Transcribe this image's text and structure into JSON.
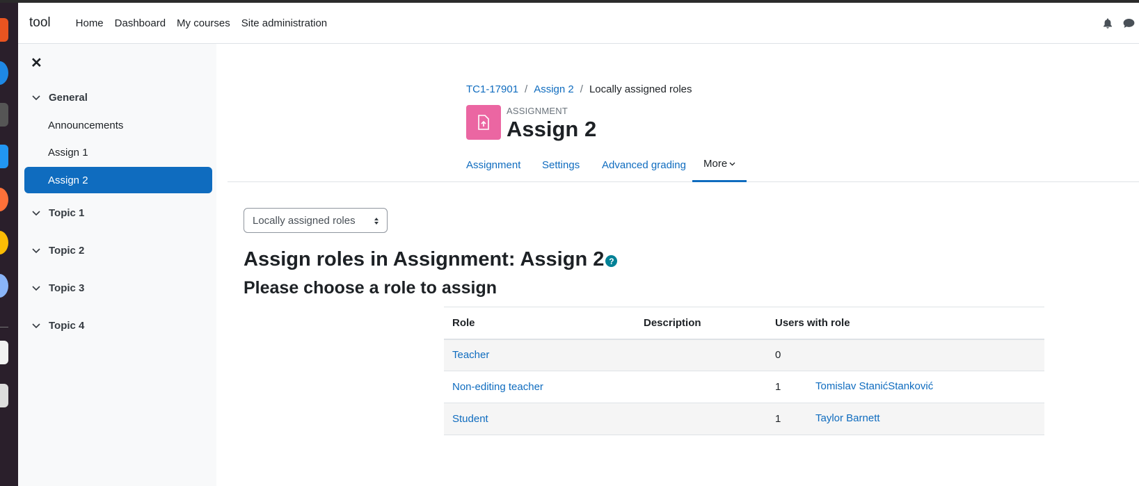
{
  "navbar": {
    "brand": "tool",
    "links": [
      "Home",
      "Dashboard",
      "My courses",
      "Site administration"
    ]
  },
  "drawer": {
    "sections": [
      {
        "title": "General",
        "items": [
          "Announcements",
          "Assign 1",
          "Assign 2"
        ],
        "active_item": "Assign 2"
      },
      {
        "title": "Topic 1"
      },
      {
        "title": "Topic 2"
      },
      {
        "title": "Topic 3"
      },
      {
        "title": "Topic 4"
      }
    ]
  },
  "breadcrumb": [
    "TC1-17901",
    "Assign 2",
    "Locally assigned roles"
  ],
  "activity": {
    "type": "ASSIGNMENT",
    "title": "Assign 2"
  },
  "secondary_nav": [
    "Assignment",
    "Settings",
    "Advanced grading",
    "More"
  ],
  "select": {
    "value": "Locally assigned roles"
  },
  "headings": {
    "h2": "Assign roles in Assignment: Assign 2",
    "h3": "Please choose a role to assign"
  },
  "roles_table": {
    "headers": [
      "Role",
      "Description",
      "Users with role"
    ],
    "rows": [
      {
        "role": "Teacher",
        "description": "",
        "count": "0",
        "users": ""
      },
      {
        "role": "Non-editing teacher",
        "description": "",
        "count": "1",
        "users": "Tomislav StanićStanković"
      },
      {
        "role": "Student",
        "description": "",
        "count": "1",
        "users": "Taylor Barnett"
      }
    ]
  },
  "colors": {
    "primary": "#0f6cbf",
    "assignment_icon_bg": "#eb66a2",
    "help_icon": "#008196"
  }
}
